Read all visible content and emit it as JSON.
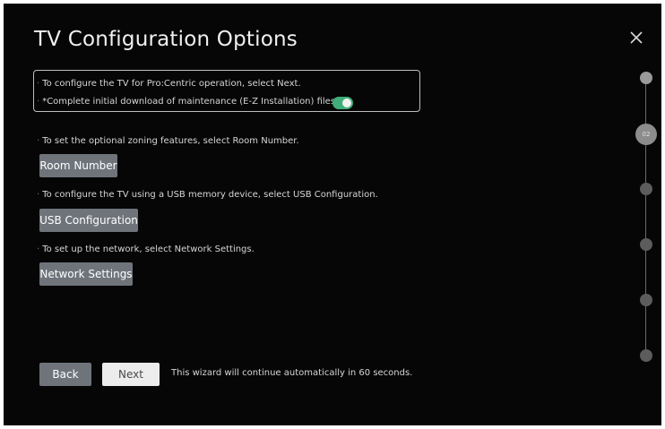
{
  "window": {
    "title": "TV Configuration Options"
  },
  "info_box": {
    "line1": "To configure the TV for Pro:Centric operation, select Next.",
    "line2": "*Complete initial download of maintenance (E-Z Installation) files.",
    "toggle_on": true,
    "toggle_color": "#3fae79"
  },
  "sections": [
    {
      "text": "To set the optional zoning features, select Room Number.",
      "button": "Room Number"
    },
    {
      "text": "To configure the TV using a USB memory device, select USB Configuration.",
      "button": "USB Configuration"
    },
    {
      "text": "To set up the network, select Network Settings.",
      "button": "Network Settings"
    }
  ],
  "footer": {
    "back_label": "Back",
    "next_label": "Next",
    "message": "This wizard will continue automatically in 60 seconds."
  },
  "progress": {
    "current_step_label": "02",
    "total_steps": 6,
    "current_step": 2
  },
  "icons": {
    "close": "close-icon"
  },
  "colors": {
    "background": "#060606",
    "button": "#6f747b",
    "accent": "#3fae79"
  }
}
